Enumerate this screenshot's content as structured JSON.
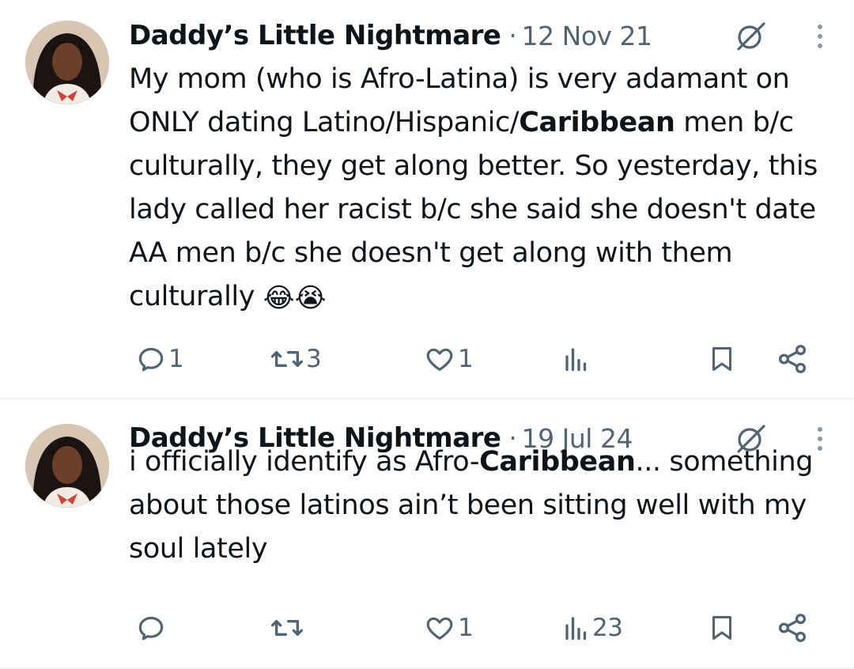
{
  "tweets": [
    {
      "author": "Daddy’s Little Nightmare",
      "separator": "·",
      "date": "12 Nov 21",
      "text_parts": [
        "My mom (who is Afro-Latina) is very adamant on ONLY dating Latino/Hispanic/",
        "Caribbean",
        " men b/c culturally, they get along better. So yesterday, this lady called her racist b/c she said she doesn't date AA men b/c she doesn't get along with them culturally "
      ],
      "emojis": [
        "😂",
        "😭"
      ],
      "counts": {
        "replies": "1",
        "retweets": "3",
        "likes": "1",
        "views": ""
      }
    },
    {
      "author": "Daddy’s Little Nightmare",
      "separator": "·",
      "date": "19 Jul 24",
      "text_parts": [
        "i officially identify as Afro-",
        "Caribbean",
        "... something about those latinos ain’t been sitting well with my soul lately"
      ],
      "counts": {
        "replies": "",
        "retweets": "",
        "likes": "1",
        "views": "23"
      }
    }
  ],
  "icons": {
    "reply": "reply-icon",
    "retweet": "retweet-icon",
    "like": "heart-icon",
    "views": "views-chart-icon",
    "bookmark": "bookmark-icon",
    "share": "share-icon",
    "grok": "grok-icon",
    "more": "more-vertical-icon"
  },
  "colors": {
    "text": "#0f1419",
    "secondary": "#536471",
    "divider": "#eff3f4"
  }
}
